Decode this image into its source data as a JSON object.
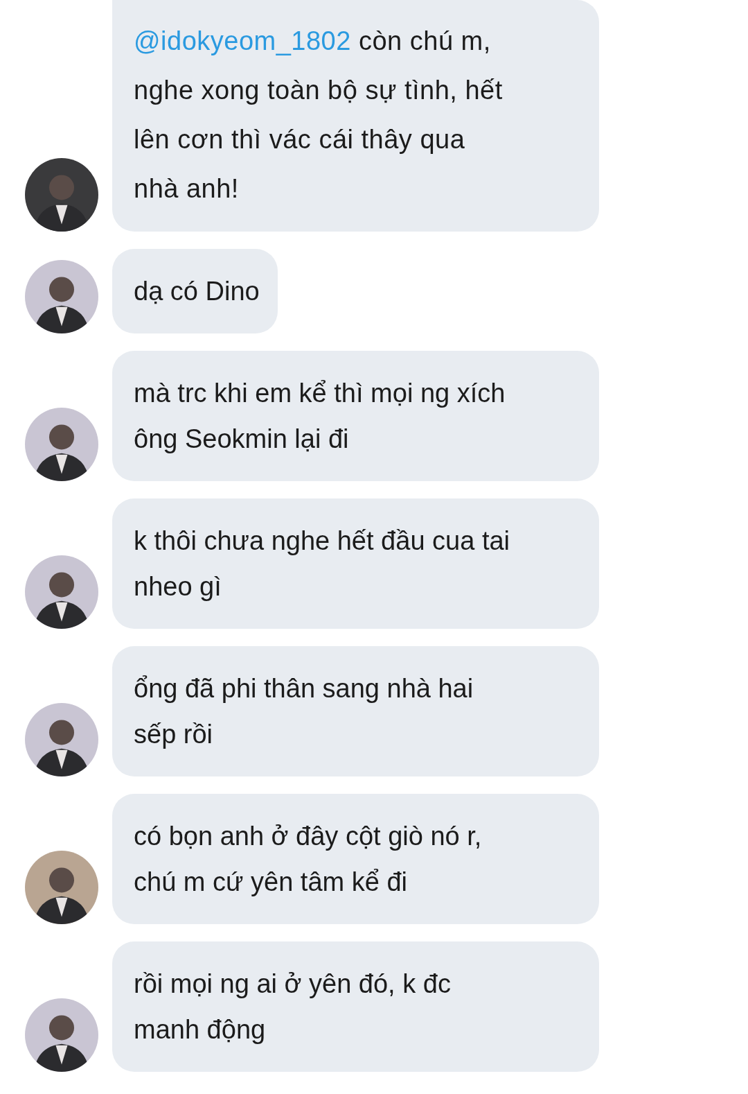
{
  "messages": [
    {
      "avatar": {
        "color": "#3a3a3c"
      },
      "mention": "@idokyeom_1802",
      "text": " còn chú m,\nnghe xong toàn bộ sự tình, hết\nlên cơn thì vác cái thây qua\nnhà anh!"
    },
    {
      "avatar": {
        "color": "#c9c5d3"
      },
      "text": "dạ có Dino"
    },
    {
      "avatar": {
        "color": "#c9c5d3"
      },
      "text": "mà trc khi em kể thì mọi ng xích\nông Seokmin lại đi"
    },
    {
      "avatar": {
        "color": "#c9c5d3"
      },
      "text": "k thôi chưa nghe hết đầu cua tai\nnheo gì"
    },
    {
      "avatar": {
        "color": "#c9c5d3"
      },
      "text": "ổng đã phi thân sang nhà hai\nsếp rồi"
    },
    {
      "avatar": {
        "color": "#b9a592"
      },
      "text": "có bọn anh ở đây cột giò nó r,\nchú m cứ yên tâm kể đi"
    },
    {
      "avatar": {
        "color": "#c9c5d3"
      },
      "text": "rồi mọi ng ai ở yên đó, k đc\nmanh động"
    }
  ]
}
